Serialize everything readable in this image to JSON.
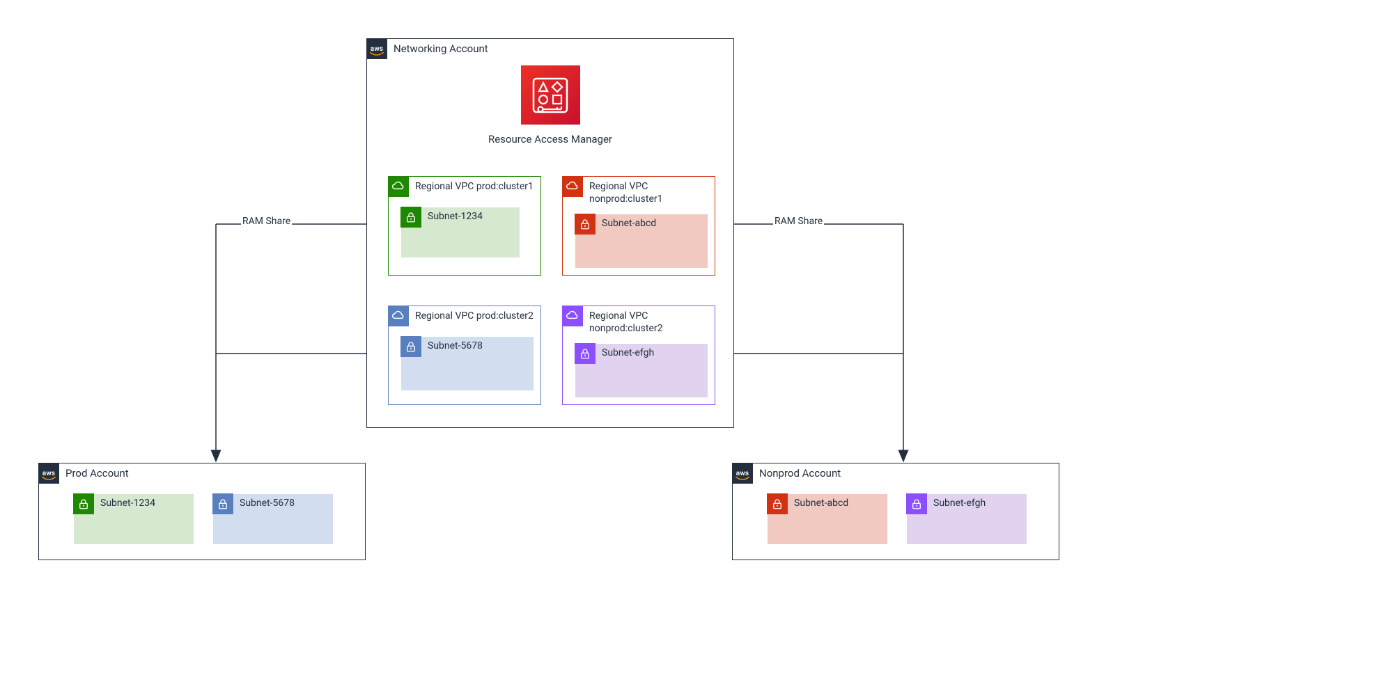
{
  "accounts": {
    "networking": {
      "title": "Networking Account"
    },
    "prod": {
      "title": "Prod Account"
    },
    "nonprod": {
      "title": "Nonprod Account"
    }
  },
  "ram": {
    "label": "Resource Access Manager"
  },
  "vpcs": {
    "prod1": {
      "title": "Regional VPC prod:cluster1"
    },
    "prod2": {
      "title": "Regional VPC prod:cluster2"
    },
    "nonprod1": {
      "title_l1": "Regional VPC",
      "title_l2": "nonprod:cluster1"
    },
    "nonprod2": {
      "title_l1": "Regional VPC",
      "title_l2": "nonprod:cluster2"
    }
  },
  "subnets": {
    "a": "Subnet-1234",
    "b": "Subnet-5678",
    "c": "Subnet-abcd",
    "d": "Subnet-efgh"
  },
  "labels": {
    "ram_share_left": "RAM Share",
    "ram_share_right": "RAM Share"
  },
  "colors": {
    "green": "#1E8900",
    "red": "#D13212",
    "blue": "#5A7FBF",
    "purple": "#8C4FFF",
    "aws": "#232F3E",
    "ram_a": "#ED3124",
    "ram_b": "#C8102E"
  }
}
